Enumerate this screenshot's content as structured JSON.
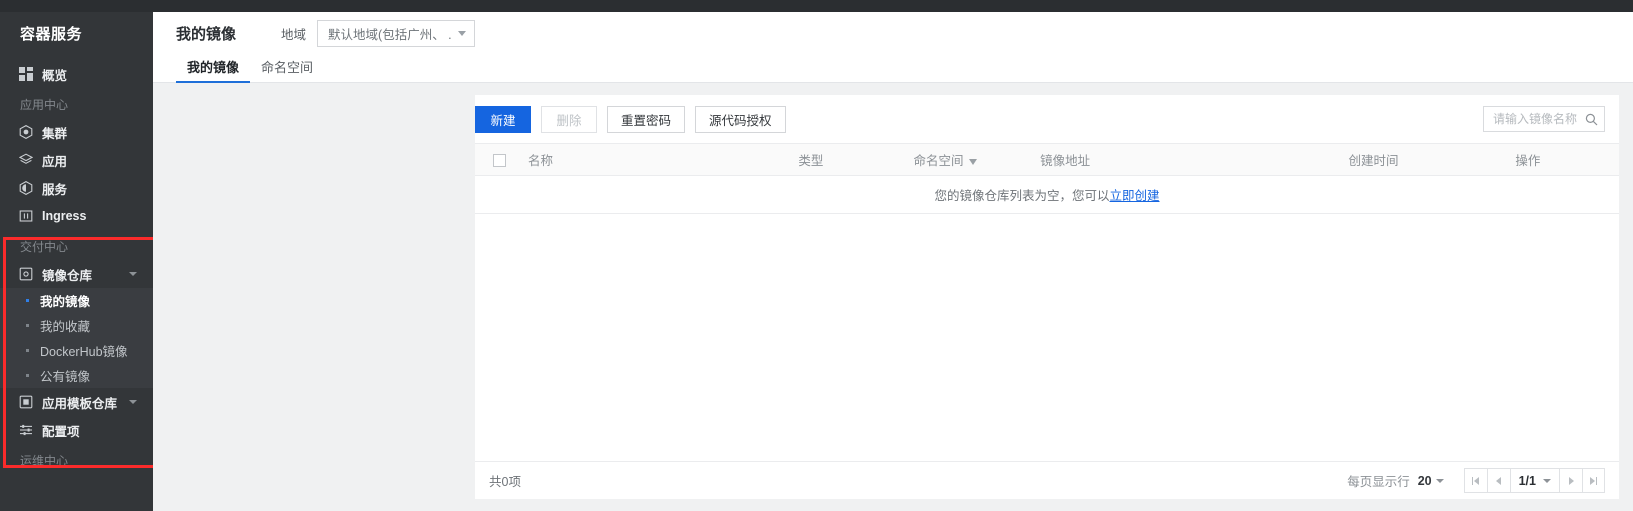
{
  "sidebar": {
    "brand": "容器服务",
    "overview": {
      "label": "概览",
      "icon": "grid-icon"
    },
    "groups": [
      {
        "title": "应用中心",
        "items": [
          {
            "label": "集群",
            "icon": "cluster-icon"
          },
          {
            "label": "应用",
            "icon": "layers-icon"
          },
          {
            "label": "服务",
            "icon": "service-icon"
          },
          {
            "label": "Ingress",
            "icon": "ingress-icon"
          }
        ]
      },
      {
        "title": "交付中心",
        "items": [
          {
            "label": "镜像仓库",
            "icon": "registry-icon",
            "expandable": true
          },
          {
            "label": "应用模板仓库",
            "icon": "template-icon",
            "expandable": true
          },
          {
            "label": "配置项",
            "icon": "config-icon"
          }
        ]
      }
    ],
    "registry_submenu": [
      {
        "label": "我的镜像",
        "active": true
      },
      {
        "label": "我的收藏",
        "active": false
      },
      {
        "label": "DockerHub镜像",
        "active": false
      },
      {
        "label": "公有镜像",
        "active": false
      }
    ],
    "ops_group_title": "运维中心"
  },
  "header": {
    "title": "我的镜像",
    "region_label": "地域",
    "region_value": "默认地域(包括广州、 ..."
  },
  "tabs": [
    {
      "label": "我的镜像",
      "active": true
    },
    {
      "label": "命名空间",
      "active": false
    }
  ],
  "toolbar": {
    "create_label": "新建",
    "delete_label": "删除",
    "reset_password_label": "重置密码",
    "source_auth_label": "源代码授权",
    "search_placeholder": "请输入镜像名称",
    "search_value": ""
  },
  "table": {
    "columns": [
      {
        "key": "check",
        "label": ""
      },
      {
        "key": "name",
        "label": "名称"
      },
      {
        "key": "type",
        "label": "类型"
      },
      {
        "key": "ns",
        "label": "命名空间",
        "filterable": true
      },
      {
        "key": "addr",
        "label": "镜像地址"
      },
      {
        "key": "time",
        "label": "创建时间"
      },
      {
        "key": "action",
        "label": "操作"
      }
    ],
    "rows": [],
    "empty_text": "您的镜像仓库列表为空，您可以",
    "empty_link": "立即创建"
  },
  "footer": {
    "total_text": "共0项",
    "rows_per_page_label": "每页显示行",
    "rows_per_page_value": "20",
    "page_indicator": "1/1"
  },
  "colors": {
    "accent": "#1565e0",
    "sidebar_bg": "#333639",
    "annotation": "#fb2b2b"
  }
}
